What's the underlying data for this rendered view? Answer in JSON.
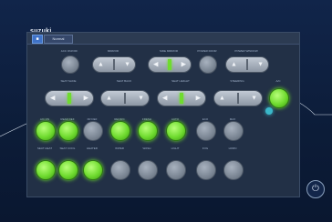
{
  "brand": "suzuki",
  "topbar": {
    "home_btn": "■",
    "tab_label": "Normal"
  },
  "row1": [
    {
      "label": "ACC ON/OFF",
      "type": "round"
    },
    {
      "label": "MIRROR",
      "type": "pill",
      "state": "grey",
      "arrows": "ud"
    },
    {
      "label": "SIDE MIRROR",
      "type": "pill",
      "state": "green",
      "arrows": "lr"
    },
    {
      "label": "POWER DOOR",
      "type": "round"
    },
    {
      "label": "POWER WINDOW",
      "type": "pill",
      "state": "grey",
      "arrows": "ud"
    }
  ],
  "row2": [
    {
      "label": "SEAT SLIDE",
      "type": "pill",
      "state": "green",
      "arrows": "lr"
    },
    {
      "label": "SEAT BACK",
      "type": "pill",
      "state": "grey",
      "arrows": "ud"
    },
    {
      "label": "SEAT HEIGHT",
      "type": "pill",
      "state": "green",
      "arrows": "lr"
    },
    {
      "label": "STEERING",
      "type": "pill",
      "state": "grey",
      "arrows": "ud"
    },
    {
      "label": "A/C",
      "type": "round",
      "state": "green"
    }
  ],
  "row3": [
    {
      "label": "A/C ON",
      "state": "green"
    },
    {
      "label": "REAR DEF",
      "state": "green"
    },
    {
      "label": "FR DEF",
      "state": "grey"
    },
    {
      "label": "RECIRC",
      "state": "green"
    },
    {
      "label": "FRESH",
      "state": "green"
    },
    {
      "label": "AUTO",
      "state": "green"
    },
    {
      "label": "ECO",
      "state": "grey"
    },
    {
      "label": "MAX",
      "state": "grey"
    }
  ],
  "row4": [
    {
      "label": "SEAT HEAT",
      "state": "green"
    },
    {
      "label": "SEAT COOL",
      "state": "green"
    },
    {
      "label": "HEATER",
      "state": "green"
    },
    {
      "label": "WIPER",
      "state": "grey"
    },
    {
      "label": "WASH",
      "state": "grey"
    },
    {
      "label": "LIGHT",
      "state": "grey"
    },
    {
      "label": "FOG",
      "state": "grey"
    },
    {
      "label": "HORN",
      "state": "grey"
    }
  ],
  "colors": {
    "bg": "#0d1e3c",
    "green": "#6fdb2f",
    "accent": "#3ab7c9"
  }
}
